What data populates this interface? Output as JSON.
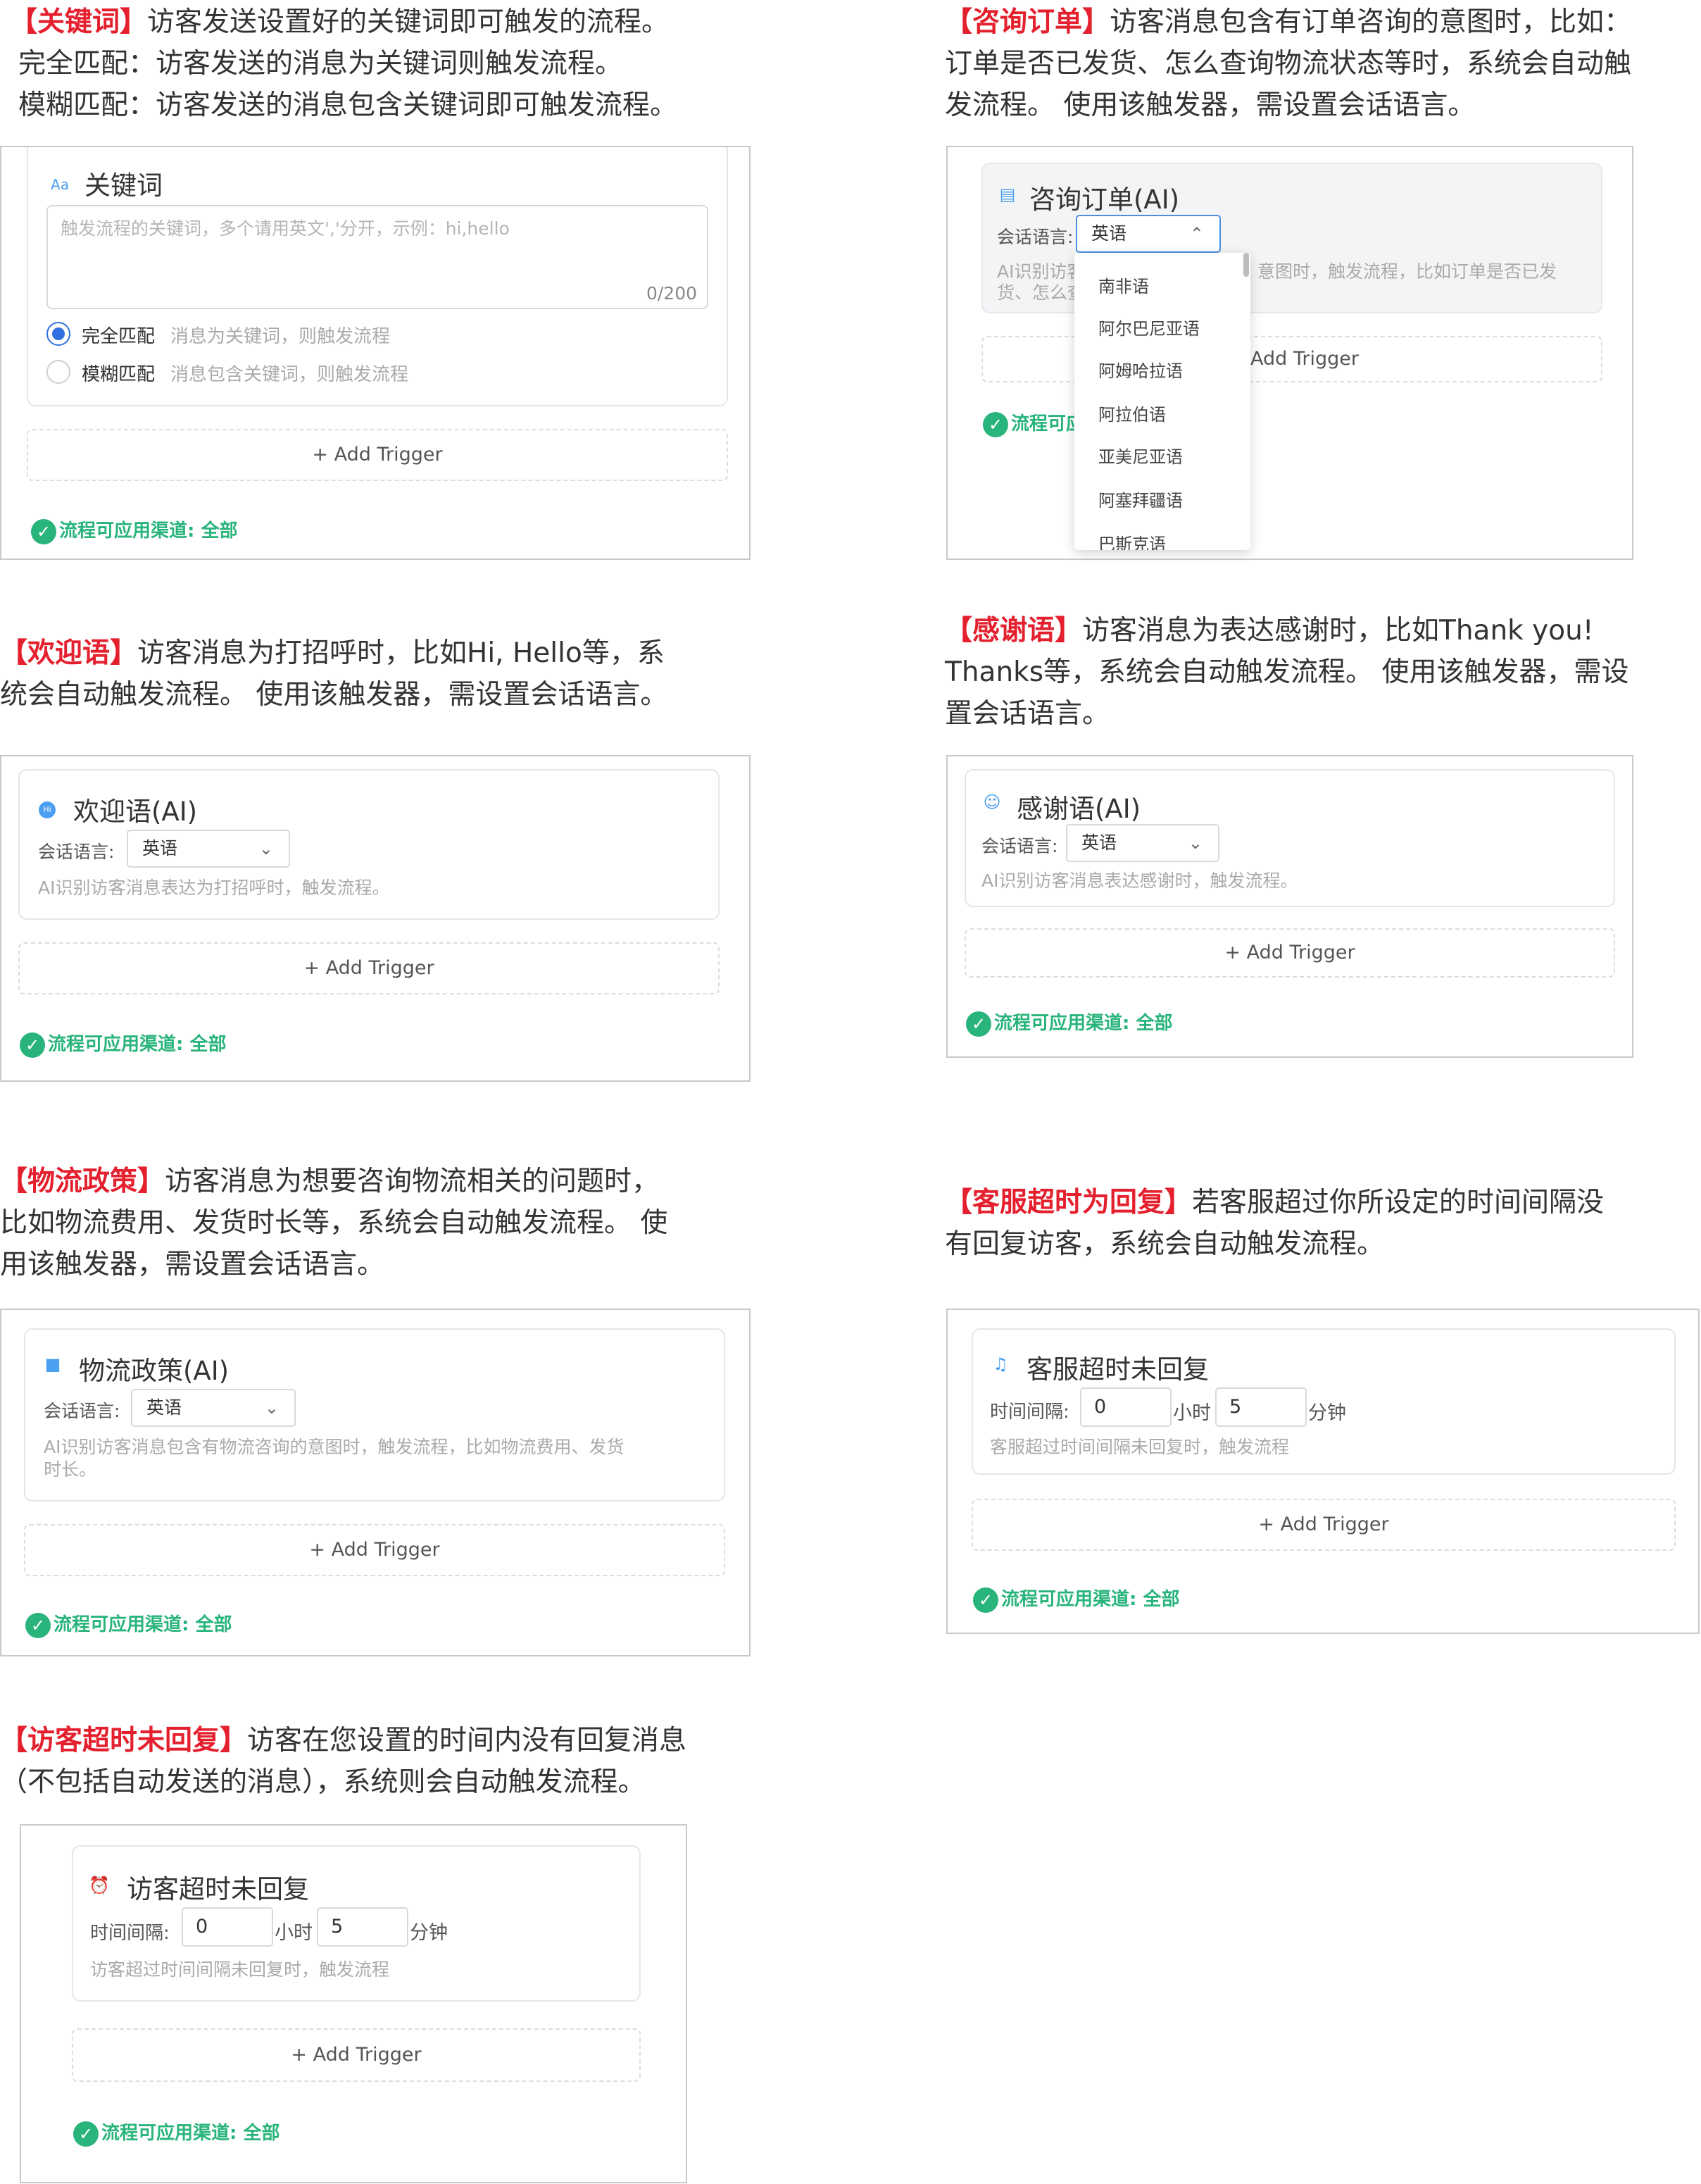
{
  "keyword": {
    "desc_title": "【关键词】",
    "desc_line1": "访客发送设置好的关键词即可触发的流程。",
    "desc_line2": "完全匹配：访客发送的消息为关键词则触发流程。",
    "desc_line3": "模糊匹配：访客发送的消息包含关键词即可触发流程。",
    "icon": "Aa",
    "title": "关键词",
    "placeholder": "触发流程的关键词，多个请用英文','分开，示例：hi,hello",
    "counter": "0/200",
    "exact_label": "完全匹配",
    "exact_desc": "消息为关键词，则触发流程",
    "fuzzy_label": "模糊匹配",
    "fuzzy_desc": "消息包含关键词，则触发流程"
  },
  "order": {
    "desc_title": "【咨询订单】",
    "desc_line1": "访客消息包含有订单咨询的意图时，比如：",
    "desc_line2": "订单是否已发货、怎么查询物流状态等时，系统会自动触",
    "desc_line3": "发流程。 使用该触发器，需设置会话语言。",
    "title": "咨询订单(AI)",
    "lang_label": "会话语言:",
    "lang_value": "英语",
    "hint_l1a": "AI识别访客",
    "hint_l1b": "意图时，触发流程，比如订单是否已发",
    "hint_l2": "货、怎么查",
    "trigger_text": "Add Trigger",
    "channel_partial": "流程可应用",
    "dropdown": [
      "南非语",
      "阿尔巴尼亚语",
      "阿姆哈拉语",
      "阿拉伯语",
      "亚美尼亚语",
      "阿塞拜疆语",
      "巴斯克语"
    ]
  },
  "welcome": {
    "desc_title": "【欢迎语】",
    "desc_line1": "访客消息为打招呼时，比如Hi, Hello等，系",
    "desc_line2": "统会自动触发流程。 使用该触发器，需设置会话语言。",
    "title": "欢迎语(AI)",
    "lang_label": "会话语言:",
    "lang_value": "英语",
    "hint": "AI识别访客消息表达为打招呼时，触发流程。"
  },
  "thanks": {
    "desc_title": "【感谢语】",
    "desc_line1": "访客消息为表达感谢时，比如Thank you!",
    "desc_line2": "Thanks等，系统会自动触发流程。 使用该触发器，需设",
    "desc_line3": "置会话语言。",
    "title": "感谢语(AI)",
    "lang_label": "会话语言:",
    "lang_value": "英语",
    "hint": "AI识别访客消息表达感谢时，触发流程。"
  },
  "logistics": {
    "desc_title": "【物流政策】",
    "desc_line1": "访客消息为想要咨询物流相关的问题时，",
    "desc_line2": "比如物流费用、发货时长等，系统会自动触发流程。 使",
    "desc_line3": "用该触发器，需设置会话语言。",
    "title": "物流政策(AI)",
    "lang_label": "会话语言:",
    "lang_value": "英语",
    "hint_l1": "AI识别访客消息包含有物流咨询的意图时，触发流程，比如物流费用、发货",
    "hint_l2": "时长。"
  },
  "agent_timeout": {
    "desc_title": "【客服超时为回复】",
    "desc_line1": "若客服超过你所设定的时间间隔没",
    "desc_line2": "有回复访客，系统会自动触发流程。",
    "title": "客服超时未回复",
    "interval_label": "时间间隔:",
    "hours": "0",
    "hours_unit": "小时",
    "minutes": "5",
    "minutes_unit": "分钟",
    "hint": "客服超过时间间隔未回复时，触发流程"
  },
  "visitor_timeout": {
    "desc_title": "【访客超时未回复】",
    "desc_line1": "访客在您设置的时间内没有回复消息",
    "desc_line2": "（不包括自动发送的消息），系统则会自动触发流程。",
    "title": "访客超时未回复",
    "interval_label": "时间间隔:",
    "hours": "0",
    "hours_unit": "小时",
    "minutes": "5",
    "minutes_unit": "分钟",
    "hint": "访客超过时间间隔未回复时，触发流程"
  },
  "common": {
    "add_trigger": "+ Add Trigger",
    "channel": "流程可应用渠道:  全部"
  },
  "colors": {
    "highlight": "#e5202e",
    "success": "#28b47b",
    "accent": "#4a9ff0"
  }
}
